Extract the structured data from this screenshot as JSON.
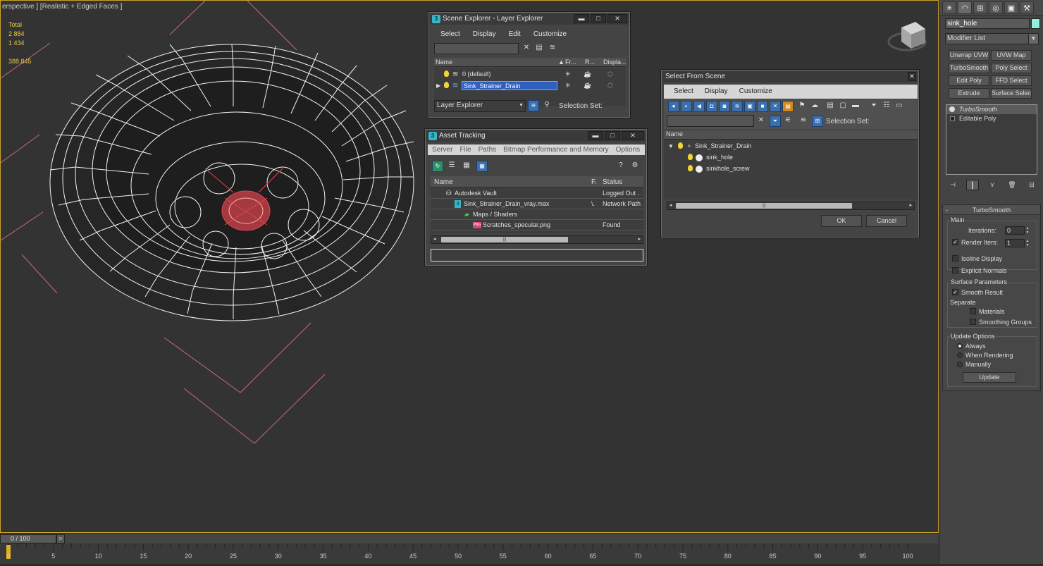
{
  "viewport": {
    "label": "erspective ] [Realistic + Edged Faces ]",
    "stats": {
      "total_label": "Total",
      "polys": "2 884",
      "verts": "1 434",
      "fps": "388.845"
    }
  },
  "timeline": {
    "frame_counter": "0 / 100",
    "next_label": ">",
    "ticks": [
      "0",
      "5",
      "10",
      "15",
      "20",
      "25",
      "30",
      "35",
      "40",
      "45",
      "50",
      "55",
      "60",
      "65",
      "70",
      "75",
      "80",
      "85",
      "90",
      "95",
      "100"
    ]
  },
  "command_panel": {
    "tabs": [
      "create-icon",
      "modify-icon",
      "hierarchy-icon",
      "motion-icon",
      "display-icon",
      "utilities-icon"
    ],
    "object_name": "sink_hole",
    "object_color": "#8ff0e0",
    "modifier_list": "Modifier List",
    "modifier_buttons": [
      "Unwrap UVW",
      "UVW Map",
      "TurboSmooth",
      "Poly Select",
      "Edit Poly",
      "FFD Select",
      "Extrude",
      "Surface Select"
    ],
    "stack": [
      "TurboSmooth",
      "Editable Poly"
    ],
    "rollout": {
      "title": "TurboSmooth",
      "main_label": "Main",
      "iterations_label": "Iterations:",
      "iterations_value": "0",
      "render_iters_label": "Render Iters:",
      "render_iters_value": "1",
      "isoline_label": "Isoline Display",
      "explicit_normals_label": "Explicit Normals",
      "surface_params_label": "Surface Parameters",
      "smooth_result_label": "Smooth Result",
      "separate_label": "Separate",
      "materials_label": "Materials",
      "smoothing_groups_label": "Smoothing Groups",
      "update_options_label": "Update Options",
      "always_label": "Always",
      "when_rendering_label": "When Rendering",
      "manually_label": "Manually",
      "update_button": "Update"
    }
  },
  "scene_explorer": {
    "title": "Scene Explorer - Layer Explorer",
    "menu": [
      "Select",
      "Display",
      "Edit",
      "Customize"
    ],
    "columns": {
      "name": "Name",
      "freeze": "Fr...",
      "render": "R...",
      "display": "Displa..."
    },
    "rows": [
      {
        "name": "0 (default)"
      },
      {
        "name": "Sink_Strainer_Drain"
      }
    ],
    "footer_dropdown": "Layer Explorer",
    "selection_set_label": "Selection Set:"
  },
  "asset_tracking": {
    "title": "Asset Tracking",
    "menu": [
      "Server",
      "File",
      "Paths",
      "Bitmap Performance and Memory",
      "Options"
    ],
    "columns": {
      "name": "Name",
      "f": "F.",
      "status": "Status"
    },
    "rows": [
      {
        "name": "Autodesk Vault",
        "f": "",
        "status": "Logged Out ."
      },
      {
        "name": "Sink_Strainer_Drain_vray.max",
        "f": "\\.",
        "status": "Network Path"
      },
      {
        "name": "Maps / Shaders",
        "f": "",
        "status": ""
      },
      {
        "name": "Scratches_specular.png",
        "f": "",
        "status": "Found"
      }
    ]
  },
  "select_from_scene": {
    "title": "Select From Scene",
    "menu": [
      "Select",
      "Display",
      "Customize"
    ],
    "selection_set_label": "Selection Set:",
    "column_name": "Name",
    "tree": [
      "Sink_Strainer_Drain",
      "sink_hole",
      "sinkhole_screw"
    ],
    "ok_label": "OK",
    "cancel_label": "Cancel"
  }
}
